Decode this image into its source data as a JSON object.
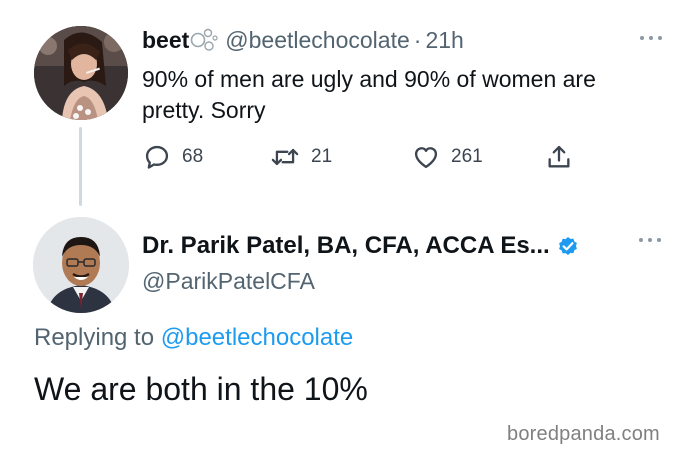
{
  "tweet_original": {
    "author_name": "beet",
    "author_handle": "@beetlechocolate",
    "separator": "·",
    "time": "21h",
    "text": "90% of men are ugly and 90% of women are pretty. Sorry",
    "actions": {
      "reply_count": "68",
      "retweet_count": "21",
      "like_count": "261"
    },
    "icons": [
      "more-options-icon",
      "reply-icon",
      "retweet-icon",
      "like-icon",
      "share-icon",
      "bubbles-emoji-icon"
    ]
  },
  "tweet_reply": {
    "author_name": "Dr. Parik Patel, BA, CFA, ACCA Es...",
    "author_handle": "@ParikPatelCFA",
    "replying_prefix": "Replying to",
    "replying_to": "@beetlechocolate",
    "text": "We are both in the 10%",
    "icons": [
      "verified-badge-icon",
      "more-options-icon"
    ]
  },
  "watermark": "boredpanda.com",
  "colors": {
    "text_primary": "#0f1419",
    "text_secondary": "#536471",
    "accent": "#1d9bf0",
    "thread_line": "#cfd9de"
  }
}
